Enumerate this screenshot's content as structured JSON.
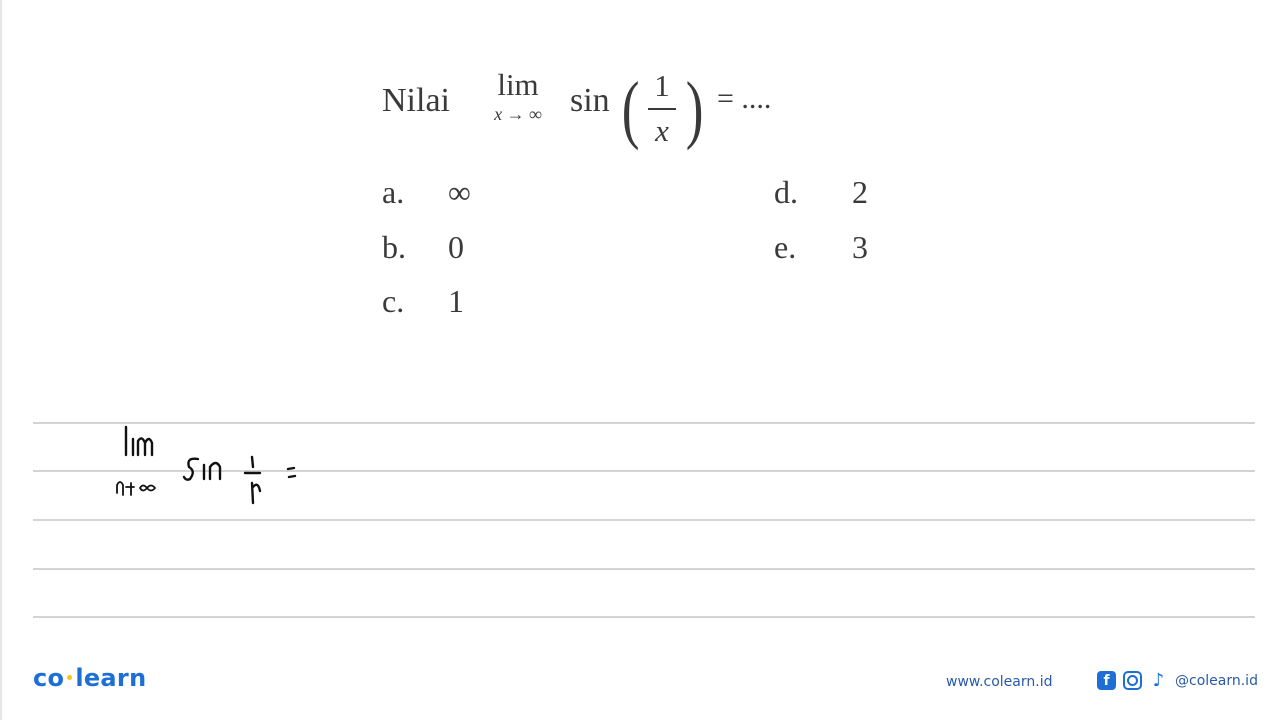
{
  "question": {
    "prefix": "Nilai",
    "lim_word": "lim",
    "lim_subscript": "x → ∞",
    "function": "sin",
    "fraction_numerator": "1",
    "fraction_denominator": "x",
    "paren_left": "(",
    "paren_right": ")",
    "suffix": "=  ...."
  },
  "options": [
    {
      "letter": "a.",
      "value": "∞"
    },
    {
      "letter": "b.",
      "value": "0"
    },
    {
      "letter": "c.",
      "value": "1"
    },
    {
      "letter": "d.",
      "value": "2"
    },
    {
      "letter": "e.",
      "value": "3"
    }
  ],
  "handwriting": {
    "lim_word": "lim",
    "lim_subscript": "x→∞",
    "function": "sin",
    "fraction_numerator": "1",
    "fraction_denominator": "x",
    "equals": "="
  },
  "footer": {
    "logo_left": "co",
    "logo_right": "learn",
    "website": "www.colearn.id",
    "social_handle": "@colearn.id",
    "icons": [
      "facebook-icon",
      "instagram-icon",
      "tiktok-icon"
    ],
    "brand_color": "#1d6fd6",
    "accent_color": "#f5c518"
  }
}
